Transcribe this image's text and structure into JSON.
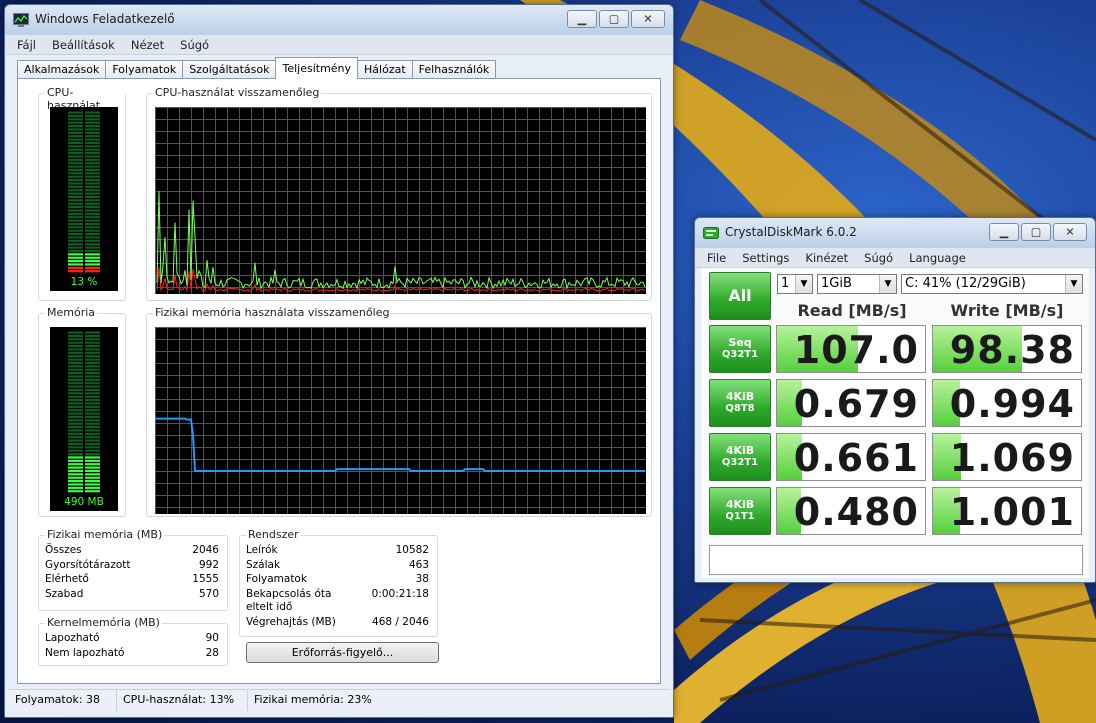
{
  "taskmgr": {
    "title": "Windows Feladatkezelő",
    "menu": [
      "Fájl",
      "Beállítások",
      "Nézet",
      "Súgó"
    ],
    "tabs": [
      "Alkalmazások",
      "Folyamatok",
      "Szolgáltatások",
      "Teljesítmény",
      "Hálózat",
      "Felhasználók"
    ],
    "active_tab": "Teljesítmény",
    "cpu_box_label": "CPU-használat",
    "cpu_history_label": "CPU-használat visszamenőleg",
    "cpu_value_text": "13 %",
    "cpu_fraction": 0.13,
    "mem_box_label": "Memória",
    "mem_history_label": "Fizikai memória használata visszamenőleg",
    "mem_value_text": "490 MB",
    "mem_fraction": 0.23,
    "physical": {
      "label": "Fizikai memória (MB)",
      "rows": [
        {
          "k": "Összes",
          "v": "2046"
        },
        {
          "k": "Gyorsítótárazott",
          "v": "992"
        },
        {
          "k": "Elérhető",
          "v": "1555"
        },
        {
          "k": "Szabad",
          "v": "570"
        }
      ]
    },
    "kernel": {
      "label": "Kernelmemória (MB)",
      "rows": [
        {
          "k": "Lapozható",
          "v": "90"
        },
        {
          "k": "Nem lapozható",
          "v": "28"
        }
      ]
    },
    "system": {
      "label": "Rendszer",
      "rows": [
        {
          "k": "Leírók",
          "v": "10582"
        },
        {
          "k": "Szálak",
          "v": "463"
        },
        {
          "k": "Folyamatok",
          "v": "38"
        },
        {
          "k": "Bekapcsolás óta",
          "k2": "eltelt idő",
          "v": "0:00:21:18"
        },
        {
          "k": "Végrehajtás (MB)",
          "v": "468 / 2046"
        }
      ]
    },
    "resource_button": "Erőforrás-figyelő...",
    "status": [
      "Folyamatok: 38",
      "CPU-használat: 13%",
      "Fizikai memória: 23%"
    ]
  },
  "cdm": {
    "title": "CrystalDiskMark 6.0.2",
    "menu": [
      "File",
      "Settings",
      "Kinézet",
      "Súgó",
      "Language"
    ],
    "count": "1",
    "size": "1GiB",
    "drive": "C: 41% (12/29GiB)",
    "all_label": "All",
    "read_header": "Read [MB/s]",
    "write_header": "Write [MB/s]",
    "rows": [
      {
        "l1": "Seq",
        "l2": "Q32T1",
        "read": "107.0",
        "write": "98.38",
        "read_frac": 0.55,
        "write_frac": 0.6
      },
      {
        "l1": "4KiB",
        "l2": "Q8T8",
        "read": "0.679",
        "write": "0.994",
        "read_frac": 0.17,
        "write_frac": 0.18
      },
      {
        "l1": "4KiB",
        "l2": "Q32T1",
        "read": "0.661",
        "write": "1.069",
        "read_frac": 0.17,
        "write_frac": 0.19
      },
      {
        "l1": "4KiB",
        "l2": "Q1T1",
        "read": "0.480",
        "write": "1.001",
        "read_frac": 0.16,
        "write_frac": 0.18
      }
    ],
    "comment": ""
  },
  "colors": {
    "graph_grid": "#0b7f3a",
    "cpu_line": "#7cff5a",
    "cpu_kernel_line": "#ff2020",
    "mem_line": "#1e9bff",
    "meter_on": "#3cff3c",
    "cdm_green": "#2faa2b"
  }
}
